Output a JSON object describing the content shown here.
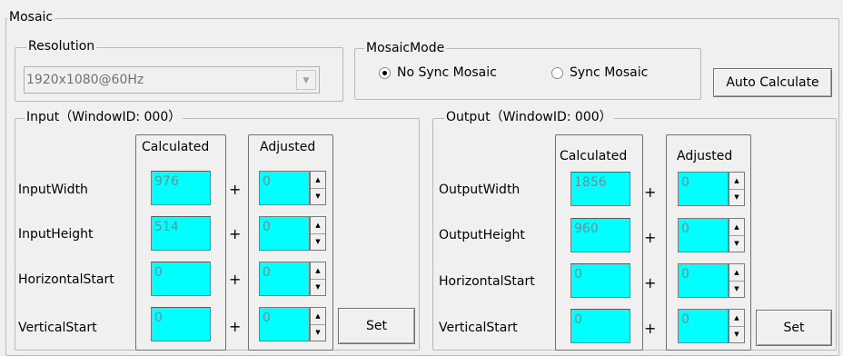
{
  "mosaic": {
    "title": "Mosaic"
  },
  "resolution": {
    "title": "Resolution",
    "selected": "1920x1080@60Hz"
  },
  "mode": {
    "title": "MosaicMode",
    "options": [
      {
        "label": "No Sync Mosaic",
        "selected": true
      },
      {
        "label": "Sync Mosaic",
        "selected": false
      }
    ]
  },
  "auto_calculate_label": "Auto Calculate",
  "input": {
    "title": "Input（WindowID: 000）",
    "calculated_header": "Calculated",
    "adjusted_header": "Adjusted",
    "rows": [
      {
        "label": "InputWidth",
        "calculated": "976",
        "adjusted": "0"
      },
      {
        "label": "InputHeight",
        "calculated": "514",
        "adjusted": "0"
      },
      {
        "label": "HorizontalStart",
        "calculated": "0",
        "adjusted": "0"
      },
      {
        "label": "VerticalStart",
        "calculated": "0",
        "adjusted": "0"
      }
    ],
    "set_label": "Set"
  },
  "output": {
    "title": "Output（WindowID: 000）",
    "calculated_header": "Calculated",
    "adjusted_header": "Adjusted",
    "rows": [
      {
        "label": "OutputWidth",
        "calculated": "1856",
        "adjusted": "0"
      },
      {
        "label": "OutputHeight",
        "calculated": "960",
        "adjusted": "0"
      },
      {
        "label": "HorizontalStart",
        "calculated": "0",
        "adjusted": "0"
      },
      {
        "label": "VerticalStart",
        "calculated": "0",
        "adjusted": "0"
      }
    ],
    "set_label": "Set"
  },
  "plus_sign": "+",
  "spin_up": "▲",
  "spin_down": "▼",
  "dropdown_arrow": "▼"
}
